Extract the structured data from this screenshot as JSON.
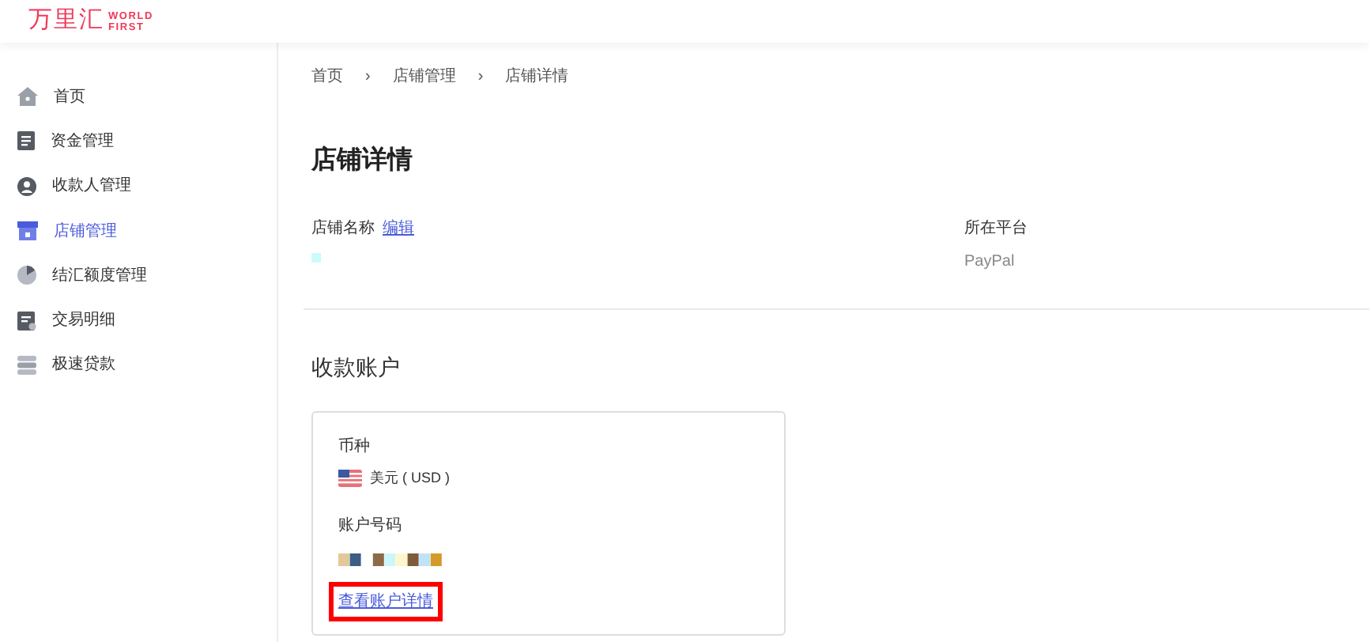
{
  "logo": {
    "name": "万里汇",
    "tagline_1": "WORLD",
    "tagline_2": "FIRST"
  },
  "sidebar": {
    "items": [
      {
        "label": "首页",
        "selected": false
      },
      {
        "label": "资金管理",
        "selected": false
      },
      {
        "label": "收款人管理",
        "selected": false
      },
      {
        "label": "店铺管理",
        "selected": true
      },
      {
        "label": "结汇额度管理",
        "selected": false
      },
      {
        "label": "交易明细",
        "selected": false
      },
      {
        "label": "极速贷款",
        "selected": false
      }
    ]
  },
  "breadcrumb": [
    {
      "label": "首页"
    },
    {
      "label": "店铺管理"
    },
    {
      "label": "店铺详情"
    }
  ],
  "breadcrumb_separator": "›",
  "page_title": "店铺详情",
  "store_name": {
    "label": "店铺名称",
    "edit_link": "编辑"
  },
  "platform": {
    "label": "所在平台",
    "value": "PayPal"
  },
  "section_title": "收款账户",
  "account_card": {
    "currency_label": "币种",
    "currency": "美元 ( USD )",
    "account_label": "账户号码",
    "details_link": "查看账户详情",
    "highlighted": true
  }
}
